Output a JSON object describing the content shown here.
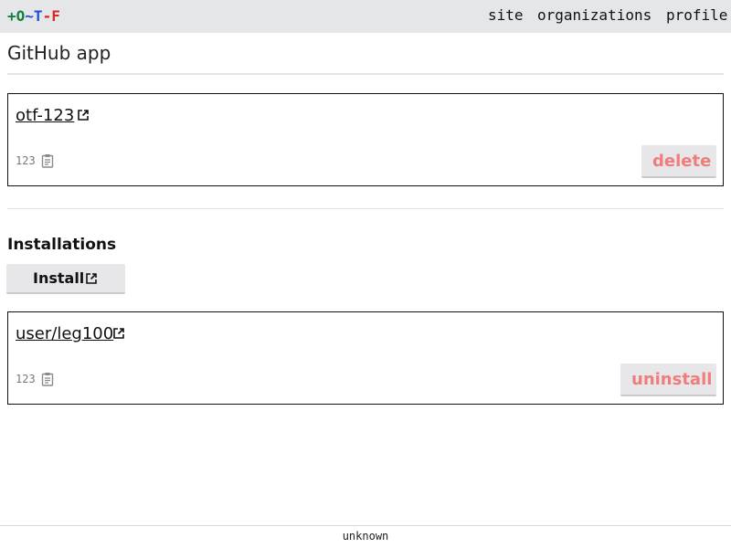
{
  "header": {
    "logo": {
      "plus": "+",
      "o": "O",
      "tilde": "~",
      "t": "T",
      "minus": "-",
      "f": "F"
    },
    "nav": {
      "site": "site",
      "organizations": "organizations",
      "profile": "profile"
    }
  },
  "page": {
    "title": "GitHub app"
  },
  "app": {
    "name": "otf-123",
    "id": "123",
    "delete_label": "delete"
  },
  "installations": {
    "heading": "Installations",
    "install_label": "Install",
    "items": [
      {
        "name": "user/leg100",
        "id": "123",
        "uninstall_label": "uninstall"
      }
    ]
  },
  "footer": {
    "version": "unknown"
  },
  "colors": {
    "logo_plus_o": "#15803d",
    "logo_tilde_t": "#1d4ed8",
    "logo_minus_f": "#dc2626",
    "danger_text": "#f07c7c",
    "topbar_bg": "#e5e6e8"
  },
  "icons": {
    "external_link": "external-link-icon",
    "clipboard": "clipboard-icon"
  }
}
